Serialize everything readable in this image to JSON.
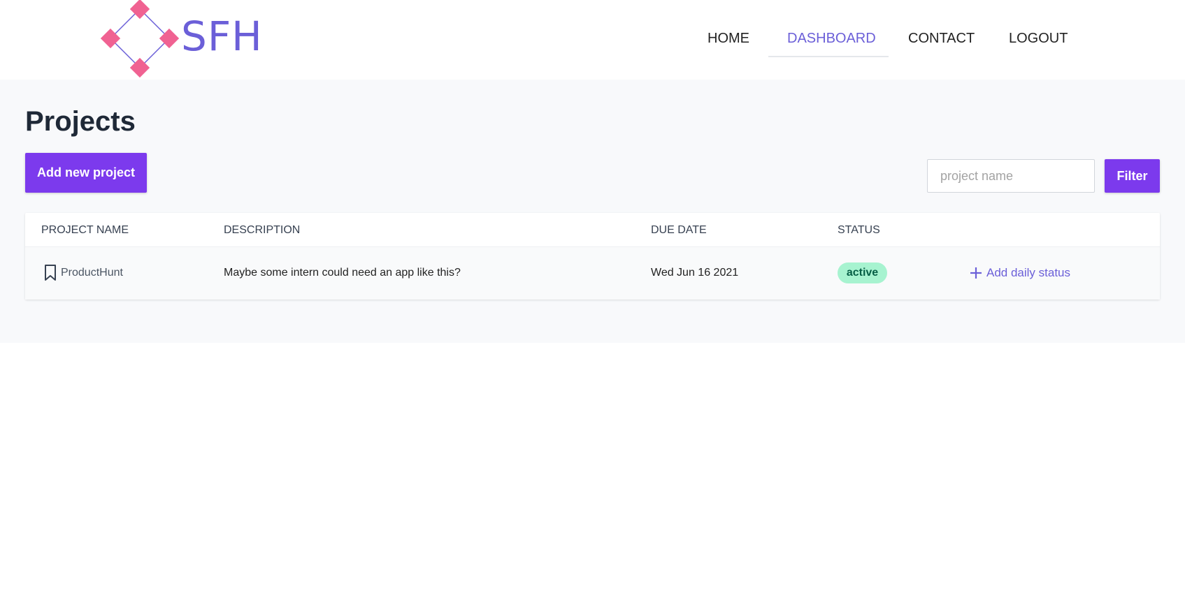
{
  "brand": {
    "name": "SFH",
    "accent_color": "#6b5fd8",
    "logo_diamond_color": "#f06292"
  },
  "nav": {
    "items": [
      {
        "label": "HOME",
        "active": false
      },
      {
        "label": "DASHBOARD",
        "active": true
      },
      {
        "label": "CONTACT",
        "active": false
      },
      {
        "label": "LOGOUT",
        "active": false
      }
    ]
  },
  "page": {
    "title": "Projects",
    "add_button_label": "Add new project",
    "search_placeholder": "project name",
    "filter_button_label": "Filter",
    "primary_color": "#7c3aed"
  },
  "table": {
    "columns": [
      "PROJECT NAME",
      "DESCRIPTION",
      "DUE DATE",
      "STATUS"
    ],
    "rows": [
      {
        "icon": "bookmark-icon",
        "name": "ProductHunt",
        "description": "Maybe some intern could need an app like this?",
        "due_date": "Wed Jun 16 2021",
        "status": "active",
        "status_color": "#a7f3d0",
        "action_icon": "plus-icon",
        "action_label": "Add daily status"
      }
    ]
  }
}
